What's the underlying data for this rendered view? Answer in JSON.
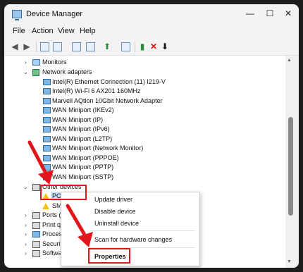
{
  "window": {
    "title": "Device Manager",
    "controls": {
      "minimize": "—",
      "maximize": "☐",
      "close": "✕"
    }
  },
  "menu": [
    "File",
    "Action",
    "View",
    "Help"
  ],
  "toolbar": [
    "back-arrow",
    "forward-arrow",
    "properties-view",
    "show-hidden",
    "help-book",
    "update-driver",
    "monitor-scan",
    "enable-device",
    "uninstall-device",
    "download-driver"
  ],
  "tree": [
    {
      "label": "Monitors",
      "expanded": false,
      "icon": "monitor"
    },
    {
      "label": "Network adapters",
      "expanded": true,
      "icon": "network"
    },
    {
      "label": "Intel(R) Ethernet Connection (11) I219-V",
      "icon": "adapter"
    },
    {
      "label": "Intel(R) Wi-Fi 6 AX201 160MHz",
      "icon": "adapter"
    },
    {
      "label": "Marvell AQtion 10Gbit Network Adapter",
      "icon": "adapter"
    },
    {
      "label": "WAN Miniport (IKEv2)",
      "icon": "adapter"
    },
    {
      "label": "WAN Miniport (IP)",
      "icon": "adapter"
    },
    {
      "label": "WAN Miniport (IPv6)",
      "icon": "adapter"
    },
    {
      "label": "WAN Miniport (L2TP)",
      "icon": "adapter"
    },
    {
      "label": "WAN Miniport (Network Monitor)",
      "icon": "adapter"
    },
    {
      "label": "WAN Miniport (PPPOE)",
      "icon": "adapter"
    },
    {
      "label": "WAN Miniport (PPTP)",
      "icon": "adapter"
    },
    {
      "label": "WAN Miniport (SSTP)",
      "icon": "adapter"
    },
    {
      "label": "Other devices",
      "expanded": true,
      "icon": "other"
    },
    {
      "label": "PCI Dev",
      "icon": "warning",
      "selected": true
    },
    {
      "label": "SM Bus",
      "icon": "warning"
    },
    {
      "label": "Ports (COM",
      "expanded": false,
      "icon": "port"
    },
    {
      "label": "Print queue",
      "expanded": false,
      "icon": "printer"
    },
    {
      "label": "Processors",
      "expanded": false,
      "icon": "cpu"
    },
    {
      "label": "Security dev",
      "expanded": false,
      "icon": "security"
    },
    {
      "label": "Software co",
      "expanded": false,
      "icon": "software"
    }
  ],
  "context_menu": {
    "items": [
      "Update driver",
      "Disable device",
      "Uninstall device",
      "Scan for hardware changes",
      "Properties"
    ]
  },
  "highlight_color": "#e0161a"
}
